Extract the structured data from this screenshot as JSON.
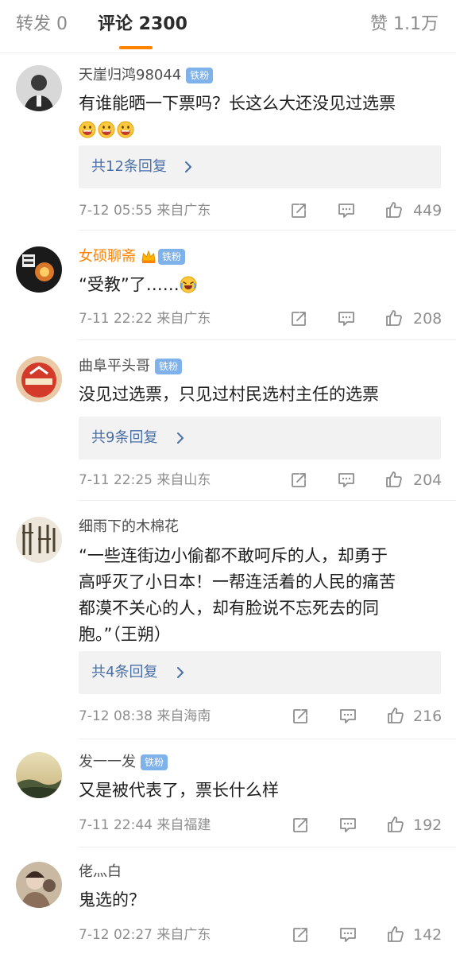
{
  "tabs": [
    {
      "label": "转发 0"
    },
    {
      "label": "评论 2300"
    },
    {
      "label": "赞 1.1万"
    }
  ],
  "colors": {
    "accent": "#ff8200",
    "link": "#4a6fa5",
    "badge": "#7fb2ea",
    "meta": "#8e8e8e"
  },
  "comments": [
    {
      "user": "天崖归鸿98044",
      "badge": "铁粉",
      "text": "有谁能晒一下票吗？长这么大还没见过选票",
      "emoji": "grinning-emoji x3",
      "replies": "共12条回复",
      "time": "7-12 05:55",
      "from": "来自广东",
      "likes": "449"
    },
    {
      "user": "女硕聊斋",
      "badge": "铁粉",
      "text": "“受教”了……",
      "emoji": "laughing-crying-emoji",
      "replies": "",
      "time": "7-11 22:22",
      "from": "来自广东",
      "likes": "208"
    },
    {
      "user": "曲阜平头哥",
      "badge": "铁粉",
      "text": "没见过选票，只见过村民选村主任的选票",
      "replies": "共9条回复",
      "time": "7-11 22:25",
      "from": "来自山东",
      "likes": "204"
    },
    {
      "user": "细雨下的木棉花",
      "badge": "",
      "text_lines": [
        "“一些连街边小偷都不敢呵斥的人，却勇于",
        "高呼灭了小日本！一帮连活着的人民的痛苦",
        "都漠不关心的人，却有脸说不忘死去的同",
        "胞。”（王朔）"
      ],
      "replies": "共4条回复",
      "time": "7-12 08:38",
      "from": "来自海南",
      "likes": "216"
    },
    {
      "user": "发一一发",
      "badge": "铁粉",
      "text": "又是被代表了，票长什么样",
      "replies": "",
      "time": "7-11 22:44",
      "from": "来自福建",
      "likes": "192"
    },
    {
      "user": "佬灬白",
      "badge": "",
      "text": "鬼选的？",
      "replies": "",
      "time": "7-12 02:27",
      "from": "来自广东",
      "likes": "142"
    }
  ],
  "icons": {
    "share": "share-icon",
    "comment": "comment-icon",
    "like": "thumbs-up-icon",
    "arrow": "chevron-right-icon"
  }
}
